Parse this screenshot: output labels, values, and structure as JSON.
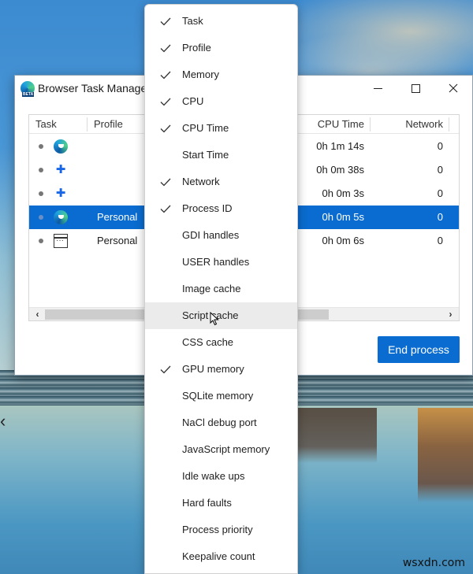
{
  "window": {
    "title": "Browser Task Manager",
    "app_icon": "edge-beta-icon",
    "controls": {
      "minimize": "minimize-icon",
      "maximize": "maximize-icon",
      "close": "close-icon"
    }
  },
  "table": {
    "columns": [
      {
        "key": "task",
        "label": "Task"
      },
      {
        "key": "profile",
        "label": "Profile"
      },
      {
        "key": "cpu_time",
        "label": "CPU Time"
      },
      {
        "key": "network",
        "label": "Network"
      }
    ],
    "rows": [
      {
        "icon": "edge-icon",
        "profile": "",
        "cpu_time": "0h 1m 14s",
        "network": "0",
        "selected": false
      },
      {
        "icon": "puzzle-icon",
        "profile": "",
        "cpu_time": "0h 0m 38s",
        "network": "0",
        "selected": false
      },
      {
        "icon": "puzzle-icon",
        "profile": "",
        "cpu_time": "0h 0m 3s",
        "network": "0",
        "selected": false
      },
      {
        "icon": "edge-icon",
        "profile": "Personal",
        "cpu_time": "0h 0m 5s",
        "network": "0",
        "selected": true
      },
      {
        "icon": "window-icon",
        "profile": "Personal",
        "cpu_time": "0h 0m 6s",
        "network": "0",
        "selected": false
      }
    ],
    "scrollbar": {
      "left_arrow": "‹",
      "right_arrow": "›"
    }
  },
  "end_process_label": "End process",
  "colors": {
    "accent": "#0a6cd0",
    "menu_hover": "#ebebeb"
  },
  "context_menu": {
    "items": [
      {
        "label": "Task",
        "checked": true
      },
      {
        "label": "Profile",
        "checked": true
      },
      {
        "label": "Memory",
        "checked": true
      },
      {
        "label": "CPU",
        "checked": true
      },
      {
        "label": "CPU Time",
        "checked": true
      },
      {
        "label": "Start Time",
        "checked": false
      },
      {
        "label": "Network",
        "checked": true
      },
      {
        "label": "Process ID",
        "checked": true
      },
      {
        "label": "GDI handles",
        "checked": false
      },
      {
        "label": "USER handles",
        "checked": false
      },
      {
        "label": "Image cache",
        "checked": false
      },
      {
        "label": "Script cache",
        "checked": false,
        "hovered": true
      },
      {
        "label": "CSS cache",
        "checked": false
      },
      {
        "label": "GPU memory",
        "checked": true
      },
      {
        "label": "SQLite memory",
        "checked": false
      },
      {
        "label": "NaCl debug port",
        "checked": false
      },
      {
        "label": "JavaScript memory",
        "checked": false
      },
      {
        "label": "Idle wake ups",
        "checked": false
      },
      {
        "label": "Hard faults",
        "checked": false
      },
      {
        "label": "Process priority",
        "checked": false
      },
      {
        "label": "Keepalive count",
        "checked": false
      }
    ]
  },
  "watermark": "wsxdn.com"
}
